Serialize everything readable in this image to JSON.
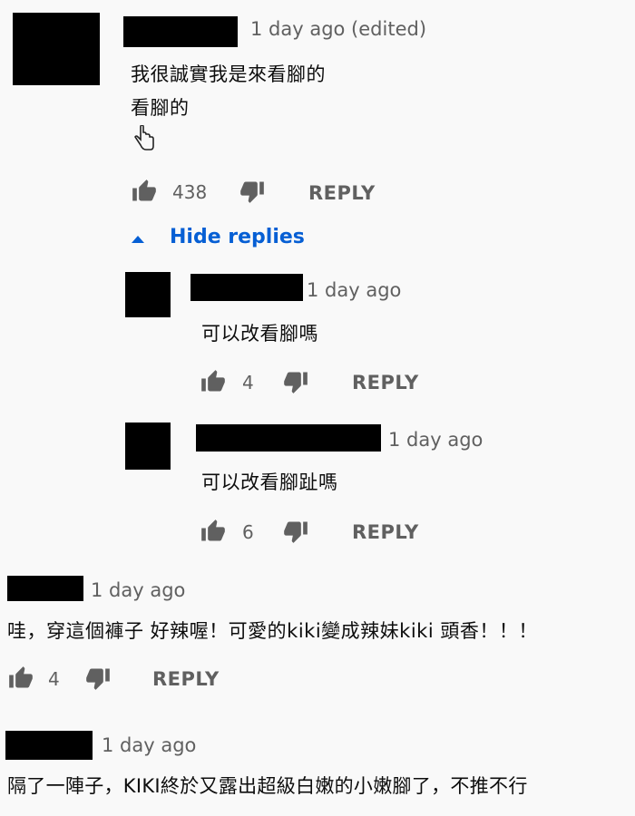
{
  "comments": [
    {
      "timestamp": "1 day ago (edited)",
      "lines": [
        "我很誠實我是來看腳的",
        "看腳的",
        "👇"
      ],
      "likes": "438",
      "reply_label": "REPLY",
      "hide_replies_label": "Hide replies",
      "replies": [
        {
          "timestamp": "1 day ago",
          "text": "可以改看腳嗎",
          "likes": "4",
          "reply_label": "REPLY"
        },
        {
          "timestamp": "1 day ago",
          "text": "可以改看腳趾嗎",
          "likes": "6",
          "reply_label": "REPLY"
        }
      ]
    },
    {
      "timestamp": "1 day ago",
      "text": "哇，穿這個褲子 好辣喔！可愛的kiki變成辣妹kiki 頭香！！！",
      "likes": "4",
      "reply_label": "REPLY"
    },
    {
      "timestamp": "1 day ago",
      "text": "隔了一陣子，KIKI終於又露出超級白嫩的小嫩腳了，不推不行"
    }
  ],
  "icons": {
    "like": "thumbs-up-icon",
    "dislike": "thumbs-down-icon",
    "pointer": "pointing-hand-icon",
    "collapse": "triangle-up-icon"
  },
  "colors": {
    "background": "#f9f9f9",
    "meta_text": "#606060",
    "link_blue": "#065fd4",
    "redaction": "#000000"
  }
}
